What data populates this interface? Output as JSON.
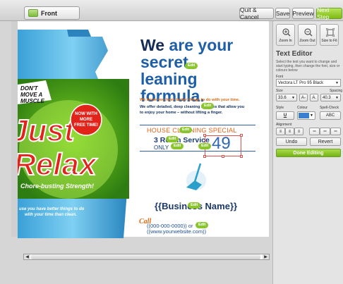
{
  "toolbar": {
    "tab_label": "Front",
    "quit_label": "Quit & Cancel",
    "save_label": "Save",
    "preview_label": "Preview",
    "next_label": "Next Step"
  },
  "document": {
    "headline_part1": "We",
    "headline_part2": "are your",
    "headline_line2_a": "secret",
    "headline_line2_b": "leaning",
    "headline_line3": "formula.",
    "tagline": "We know you have better things to do with your time.",
    "body_line1": "We offer detailed, deep cleaning services that allow you",
    "body_line2": "to enjoy your home – without lifting a finger.",
    "special_title": "HOUSE CLEANING SPECIAL",
    "service_text": "3 Room Service",
    "only_text": "ONLY",
    "price": "49",
    "business_name": "{{Business Name}}",
    "call_label": "Call",
    "phone": "((000-000-0000)) or",
    "website": "((www.yourwebsite.com))",
    "edit_label": "Edit",
    "bottle_tagline1": "DON'T",
    "bottle_tagline2": "MOVE A",
    "bottle_tagline3": "MUSCLE",
    "bottle_brand1": "Just",
    "bottle_brand2": "Relax",
    "bottle_badge1": "NOW WITH",
    "bottle_badge2": "MORE",
    "bottle_badge3": "FREE TIME!",
    "bottle_slogan": "Chore-busting Strength!",
    "bottle_footer1": "use you have better things to do",
    "bottle_footer2": "with your time than clean."
  },
  "panel": {
    "zoom_in": "Zoom In",
    "zoom_out": "Zoom Out",
    "size_to_fit": "Size to Fit",
    "title": "Text Editor",
    "hint": "Select the text you want to change and start typing, then change the font, size or colours below",
    "font_label": "Font",
    "font_value": "Vectora LT Pro 95 Black",
    "size_label": "Size",
    "spacing_label": "Spacing",
    "size_value": "33.6",
    "spacing_value": "40.3",
    "style_label": "Style",
    "colour_label": "Colour",
    "spellcheck_label": "Spell-Check",
    "underline_label": "U",
    "abc_label": "ABC",
    "alignment_label": "Alignment",
    "undo_label": "Undo",
    "revert_label": "Revert",
    "done_label": "Done Editing"
  },
  "colors": {
    "accent_green": "#8bc52e",
    "headline_blue": "#1e5fa7",
    "orange": "#e36a13"
  }
}
